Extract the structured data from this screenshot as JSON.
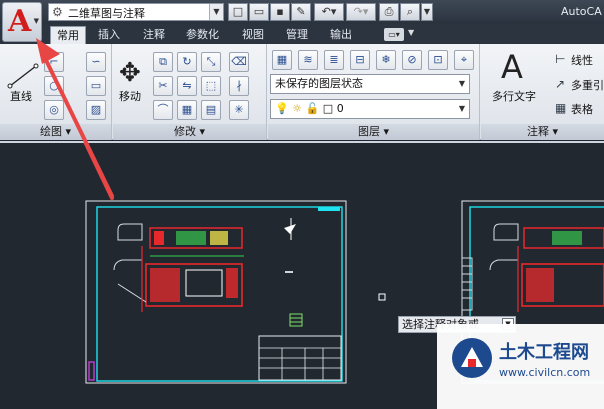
{
  "titlebar": {
    "workspace_name": "二维草图与注释",
    "app_title": "AutoCA"
  },
  "tabs": [
    "常用",
    "插入",
    "注释",
    "参数化",
    "视图",
    "管理",
    "输出"
  ],
  "panels": {
    "draw": {
      "title": "绘图 ▾",
      "line_label": "直线"
    },
    "modify": {
      "title": "修改 ▾",
      "move_label": "移动"
    },
    "layers": {
      "title": "图层 ▾",
      "layer_state": "未保存的图层状态",
      "layer_current": "0"
    },
    "annotation": {
      "title": "注释 ▾",
      "mtext_label": "多行文字",
      "big_letter": "A",
      "items": [
        "线性",
        "多重引",
        "表格"
      ]
    }
  },
  "tooltip": {
    "text": "选择注释对象或"
  },
  "watermark": {
    "name": "土木工程网",
    "url": "www.civilcn.com"
  },
  "colors": {
    "drawing_background": "#212830",
    "frame_cyan": "#1fe3f0",
    "accent_red": "#e8292c",
    "arrow_red": "#e84545"
  }
}
